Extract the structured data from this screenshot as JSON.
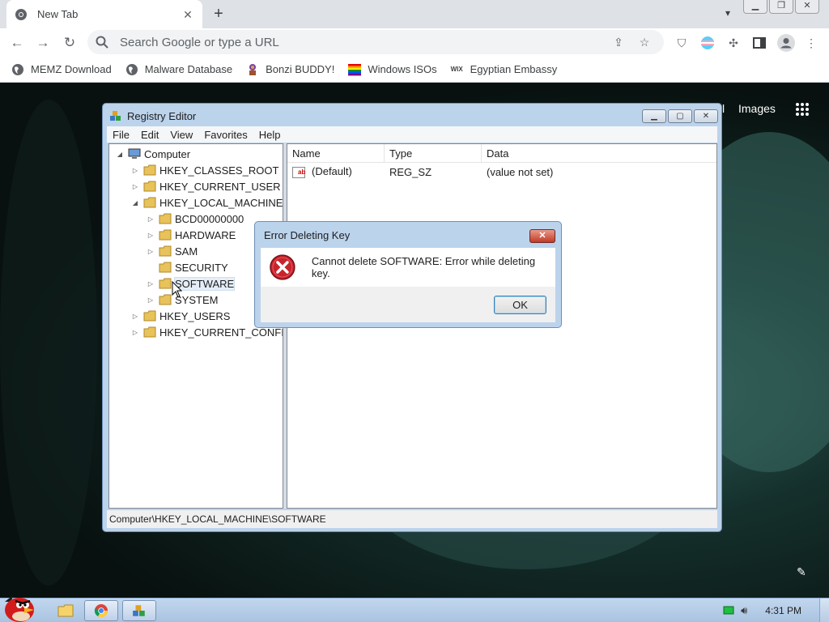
{
  "browser": {
    "tab_title": "New Tab",
    "tab_close": "✕",
    "new_tab": "+",
    "omnibox_placeholder": "Search Google or type a URL",
    "bookmarks": [
      {
        "label": "MEMZ Download",
        "icon": "globe-icon"
      },
      {
        "label": "Malware Database",
        "icon": "globe-icon"
      },
      {
        "label": "Bonzi BUDDY!",
        "icon": "bonzi-icon"
      },
      {
        "label": "Windows ISOs",
        "icon": "rainbow-flag-icon"
      },
      {
        "label": "Egyptian Embassy",
        "icon": "wix-icon"
      }
    ],
    "wix_text": "WIX"
  },
  "newtab_page": {
    "images_link": "Images",
    "partial_link": "l"
  },
  "regedit": {
    "title": "Registry Editor",
    "menu": [
      "File",
      "Edit",
      "View",
      "Favorites",
      "Help"
    ],
    "tree": [
      {
        "label": "Computer",
        "expander": "◢"
      },
      {
        "label": "HKEY_CLASSES_ROOT",
        "expander": "▷"
      },
      {
        "label": "HKEY_CURRENT_USER",
        "expander": "▷"
      },
      {
        "label": "HKEY_LOCAL_MACHINE",
        "expander": "◢"
      },
      {
        "label": "BCD00000000",
        "expander": "▷"
      },
      {
        "label": "HARDWARE",
        "expander": "▷"
      },
      {
        "label": "SAM",
        "expander": "▷"
      },
      {
        "label": "SECURITY",
        "expander": ""
      },
      {
        "label": "SOFTWARE",
        "expander": "▷"
      },
      {
        "label": "SYSTEM",
        "expander": "▷"
      },
      {
        "label": "HKEY_USERS",
        "expander": "▷"
      },
      {
        "label": "HKEY_CURRENT_CONFIG",
        "expander": "▷"
      }
    ],
    "columns": [
      "Name",
      "Type",
      "Data"
    ],
    "rows": [
      {
        "name": "(Default)",
        "type": "REG_SZ",
        "data": "(value not set)",
        "icon_text": "ab"
      }
    ],
    "status": "Computer\\HKEY_LOCAL_MACHINE\\SOFTWARE"
  },
  "error_dialog": {
    "title": "Error Deleting Key",
    "message": "Cannot delete SOFTWARE:  Error while deleting key.",
    "ok_label": "OK",
    "close_glyph": "✕"
  },
  "taskbar": {
    "clock": "4:31 PM"
  },
  "colors": {
    "error_red": "#c8232c",
    "chrome_bg": "#dee1e6",
    "aero_frame": "#bcd3ec",
    "taskbar": "#b3cbe6"
  }
}
